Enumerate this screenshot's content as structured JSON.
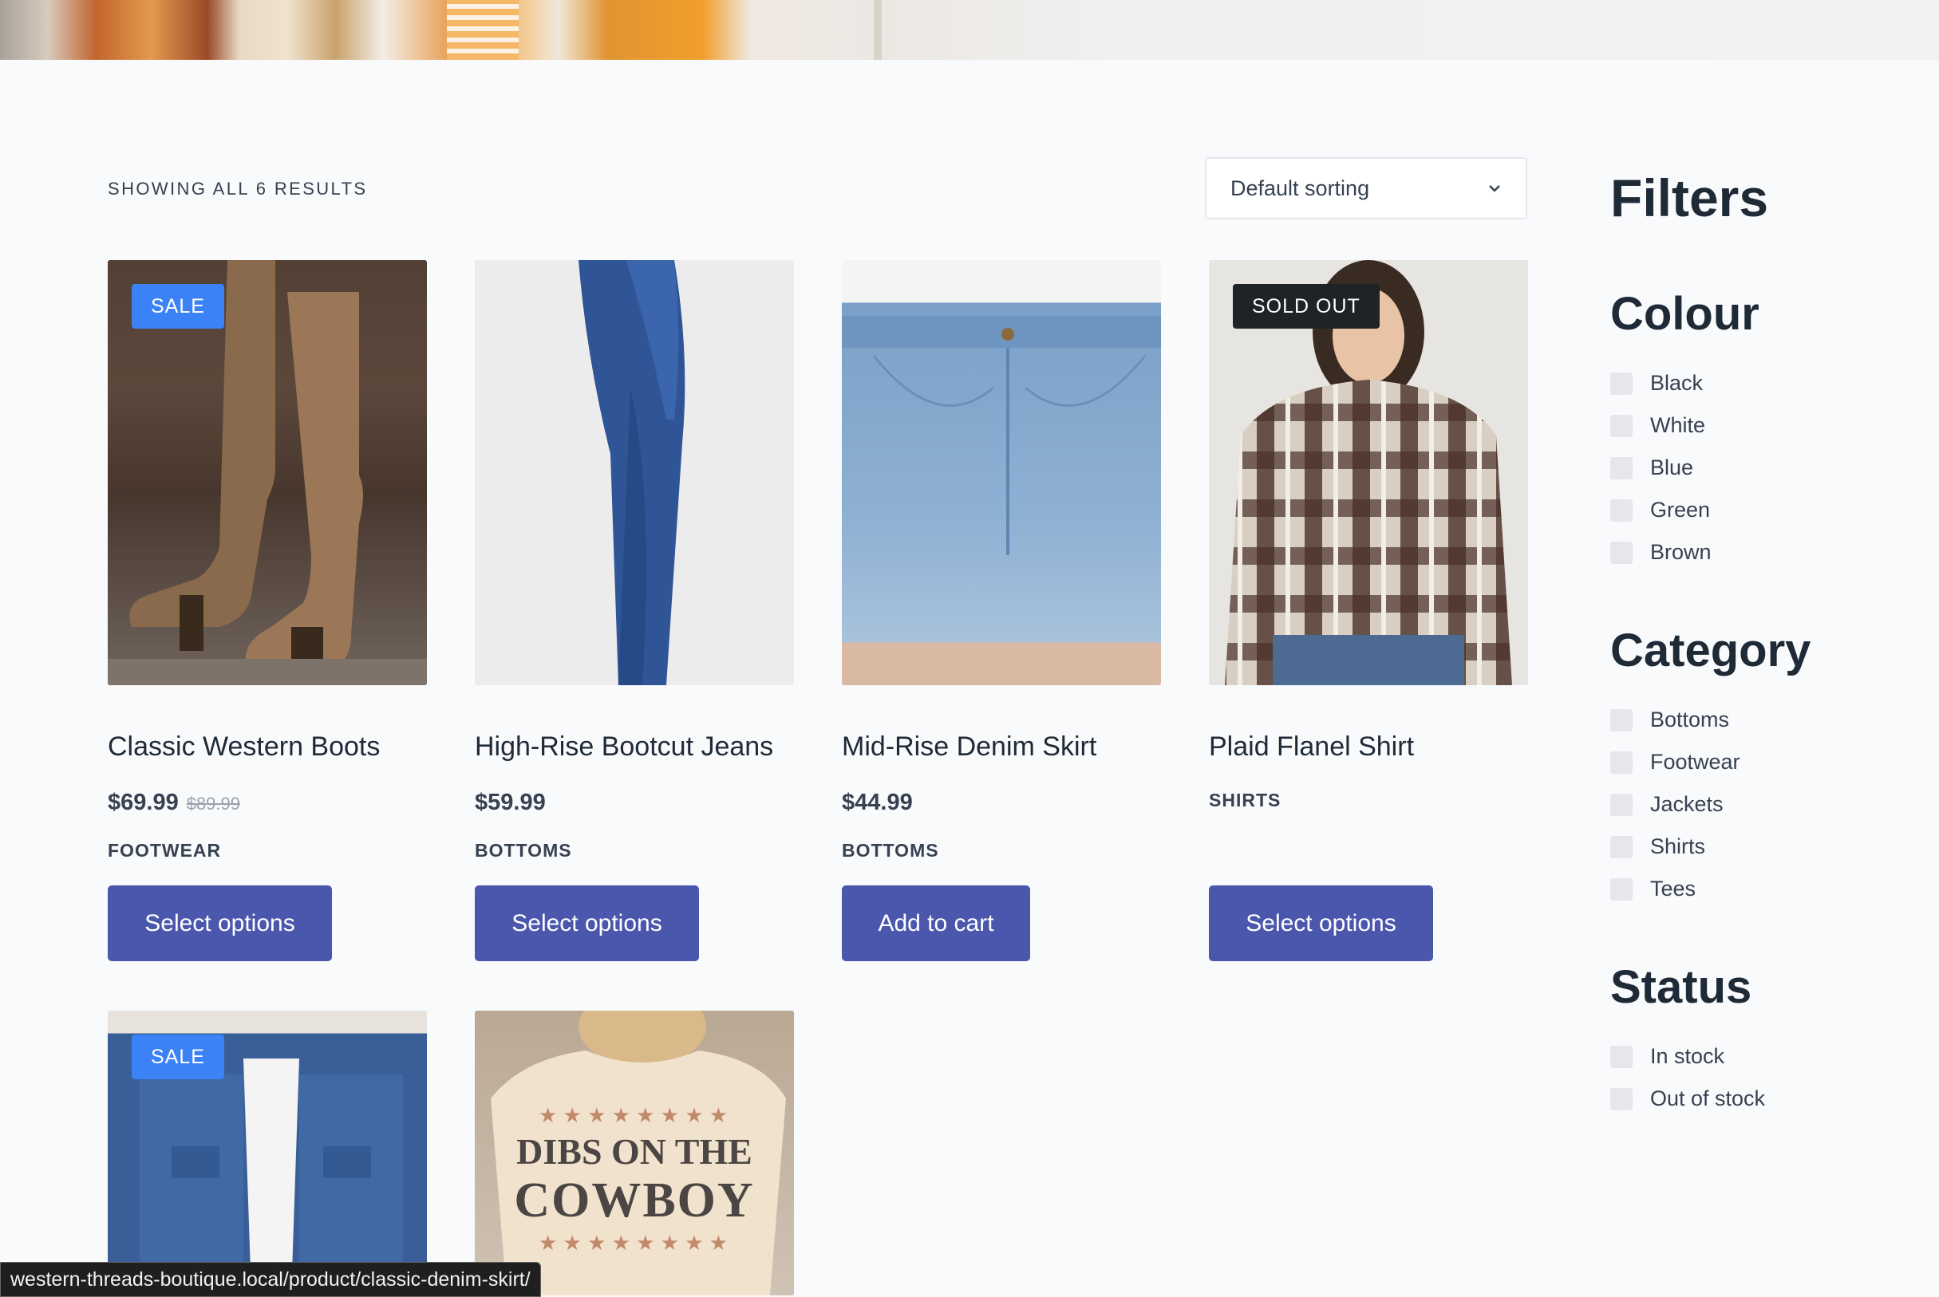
{
  "results": {
    "count_text": "SHOWING ALL 6 RESULTS"
  },
  "sorting": {
    "selected": "Default sorting"
  },
  "products": [
    {
      "title": "Classic Western Boots",
      "price": "$69.99",
      "old_price": "$89.99",
      "category": "FOOTWEAR",
      "button": "Select options",
      "badge": "SALE"
    },
    {
      "title": "High-Rise Bootcut Jeans",
      "price": "$59.99",
      "category": "BOTTOMS",
      "button": "Select options"
    },
    {
      "title": "Mid-Rise Denim Skirt",
      "price": "$44.99",
      "category": "BOTTOMS",
      "button": "Add to cart"
    },
    {
      "title": "Plaid Flanel Shirt",
      "category": "SHIRTS",
      "button": "Select options",
      "badge": "SOLD OUT"
    },
    {
      "badge": "SALE"
    },
    {
      "tee_print_line1": "DIBS ON THE",
      "tee_print_line2": "COWBOY"
    }
  ],
  "filters": {
    "heading": "Filters",
    "colour": {
      "heading": "Colour",
      "options": [
        "Black",
        "White",
        "Blue",
        "Green",
        "Brown"
      ]
    },
    "category": {
      "heading": "Category",
      "options": [
        "Bottoms",
        "Footwear",
        "Jackets",
        "Shirts",
        "Tees"
      ]
    },
    "status": {
      "heading": "Status",
      "options": [
        "In stock",
        "Out of stock"
      ]
    }
  },
  "status_bar": {
    "url": "western-threads-boutique.local/product/classic-denim-skirt/"
  },
  "colors": {
    "button": "#4a57ad",
    "sale_badge": "#3b82f6",
    "soldout_badge": "#1f2326"
  }
}
